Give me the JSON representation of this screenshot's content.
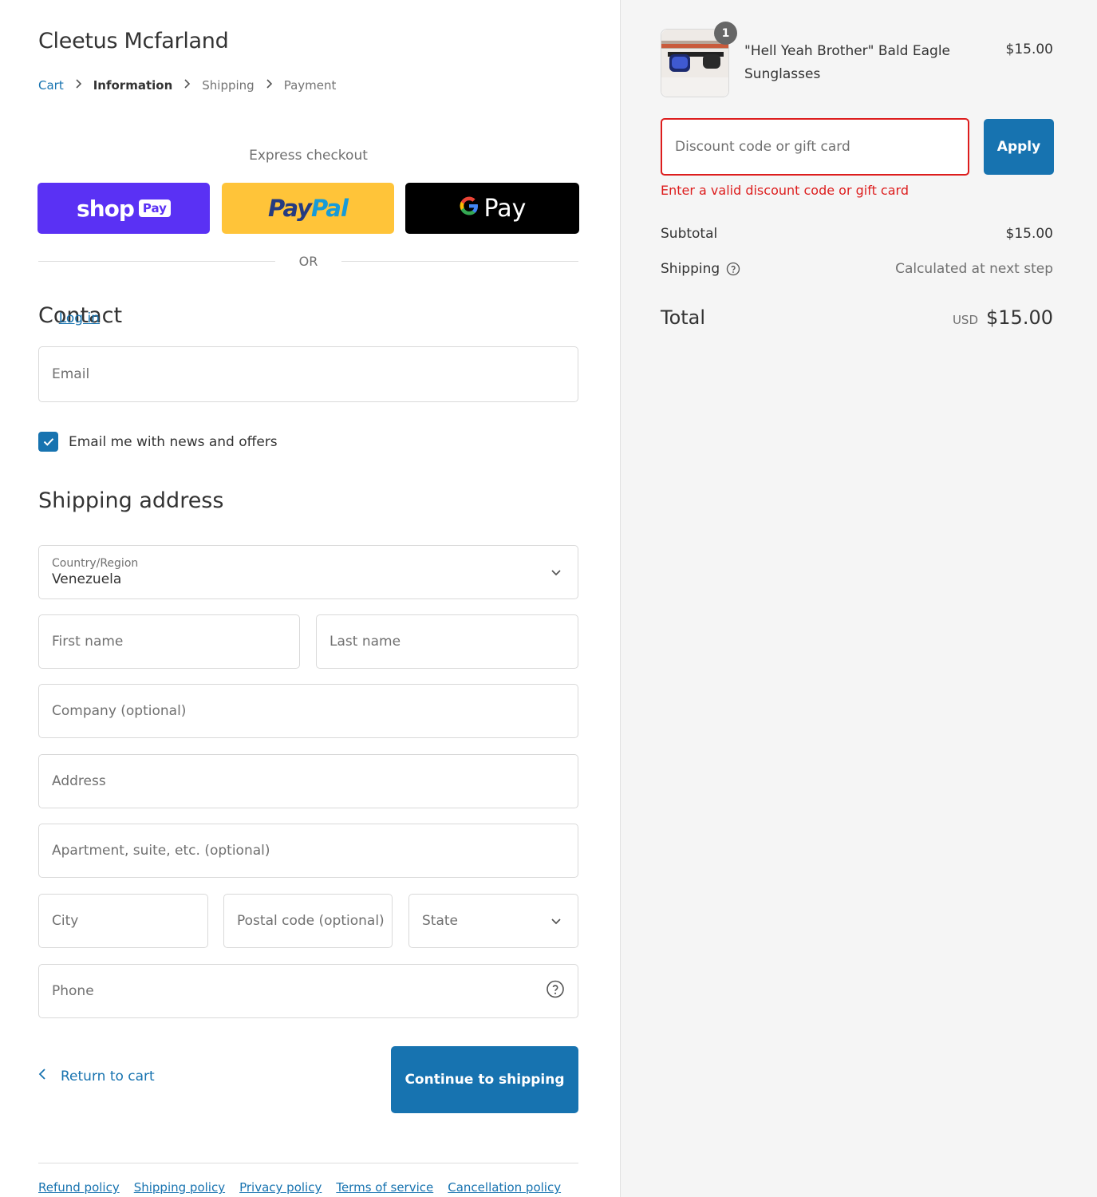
{
  "store": {
    "name": "Cleetus Mcfarland"
  },
  "breadcrumb": {
    "items": [
      "Cart",
      "Information",
      "Shipping",
      "Payment"
    ]
  },
  "express": {
    "label": "Express checkout",
    "shop_word": "shop",
    "shop_tag": "Pay",
    "paypal_a": "Pay",
    "paypal_b": "Pal",
    "gpay_g": "G",
    "gpay_word": "Pay",
    "or": "OR"
  },
  "contact": {
    "title": "Contact",
    "login": "Log in",
    "email_placeholder": "Email",
    "newsletter_label": "Email me with news and offers",
    "newsletter_checked": true
  },
  "shipping_address": {
    "title": "Shipping address",
    "country_label": "Country/Region",
    "country_value": "Venezuela",
    "first_name": "First name",
    "last_name": "Last name",
    "company": "Company (optional)",
    "address": "Address",
    "apartment": "Apartment, suite, etc. (optional)",
    "city": "City",
    "postal": "Postal code (optional)",
    "state": "State",
    "phone": "Phone"
  },
  "actions": {
    "return": "Return to cart",
    "continue": "Continue to shipping"
  },
  "footer": {
    "links": [
      "Refund policy",
      "Shipping policy",
      "Privacy policy",
      "Terms of service",
      "Cancellation policy"
    ]
  },
  "summary": {
    "product_name": "\"Hell Yeah Brother\" Bald Eagle Sunglasses",
    "product_price": "$15.00",
    "quantity": "1",
    "discount_placeholder": "Discount code or gift card",
    "apply": "Apply",
    "error": "Enter a valid discount code or gift card",
    "subtotal_label": "Subtotal",
    "subtotal_value": "$15.00",
    "shipping_label": "Shipping",
    "shipping_value": "Calculated at next step",
    "total_label": "Total",
    "total_currency": "USD",
    "total_value": "$15.00"
  },
  "colors": {
    "accent": "#1773b0",
    "error": "#dd1d1d",
    "shop_pay": "#5a31f4",
    "paypal": "#ffc439"
  }
}
